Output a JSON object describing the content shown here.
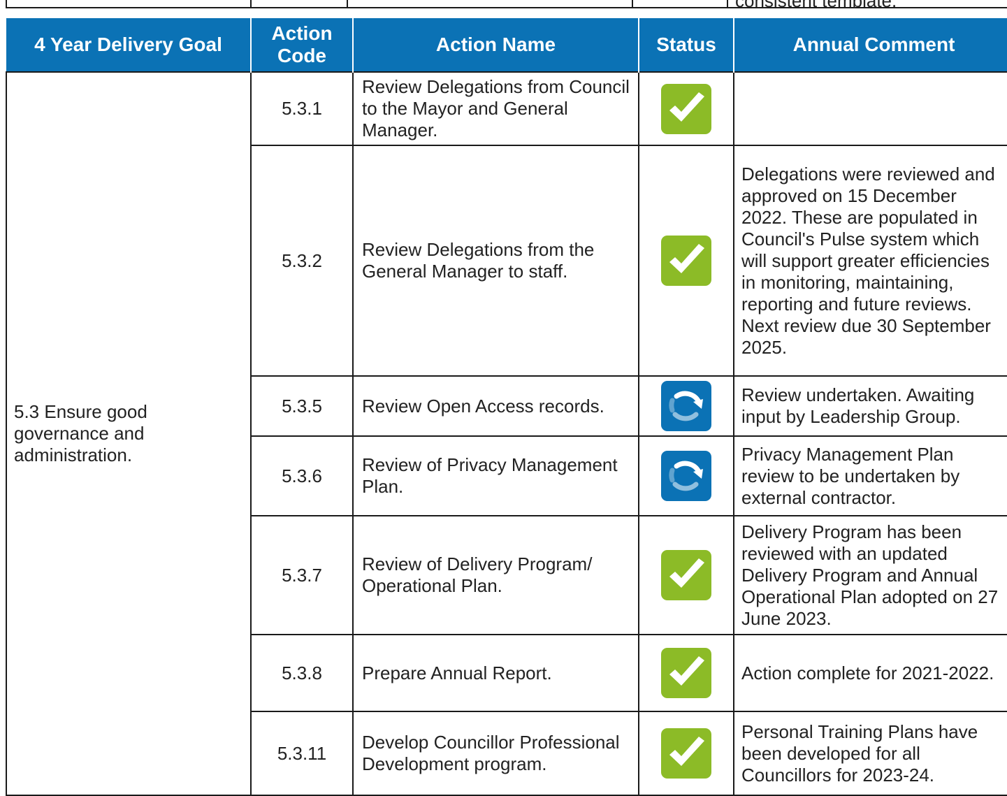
{
  "top_fragment": "consistent template.",
  "header": {
    "goal": "4 Year Delivery Goal",
    "code_line1": "Action",
    "code_line2": "Code",
    "name": "Action Name",
    "status": "Status",
    "comment": "Annual Comment"
  },
  "goal_text": "5.3 Ensure good governance and administration.",
  "status_icons": {
    "complete": {
      "name": "check-complete-icon",
      "color": "#8cbb27"
    },
    "in_progress": {
      "name": "in-progress-icon",
      "color": "#0b72b5"
    }
  },
  "rows": [
    {
      "code": "5.3.1",
      "name": "Review Delegations from Council to the Mayor and General Manager.",
      "status": "complete",
      "comment": ""
    },
    {
      "code": "5.3.2",
      "name": "Review Delegations from the General Manager to staff.",
      "status": "complete",
      "comment": "Delegations were reviewed and approved on 15 December 2022.  These are populated in Council's Pulse system which will support greater efficiencies in monitoring, maintaining, reporting and future reviews. Next review due 30 September 2025."
    },
    {
      "code": "5.3.5",
      "name": "Review Open Access records.",
      "status": "in_progress",
      "comment": "Review undertaken. Awaiting input by Leadership Group."
    },
    {
      "code": "5.3.6",
      "name": "Review of Privacy Management Plan.",
      "status": "in_progress",
      "comment": "Privacy Management Plan review to be undertaken by external contractor."
    },
    {
      "code": "5.3.7",
      "name": "Review of Delivery Program/ Operational Plan.",
      "status": "complete",
      "comment": "Delivery Program has been reviewed with an updated Delivery Program and Annual Operational Plan adopted on 27 June 2023."
    },
    {
      "code": "5.3.8",
      "name": "Prepare Annual Report.",
      "status": "complete",
      "comment": "Action complete for 2021-2022."
    },
    {
      "code": "5.3.11",
      "name": "Develop Councillor Professional Development program.",
      "status": "complete",
      "comment": "Personal Training Plans have been developed for all Councillors for 2023-24."
    }
  ]
}
